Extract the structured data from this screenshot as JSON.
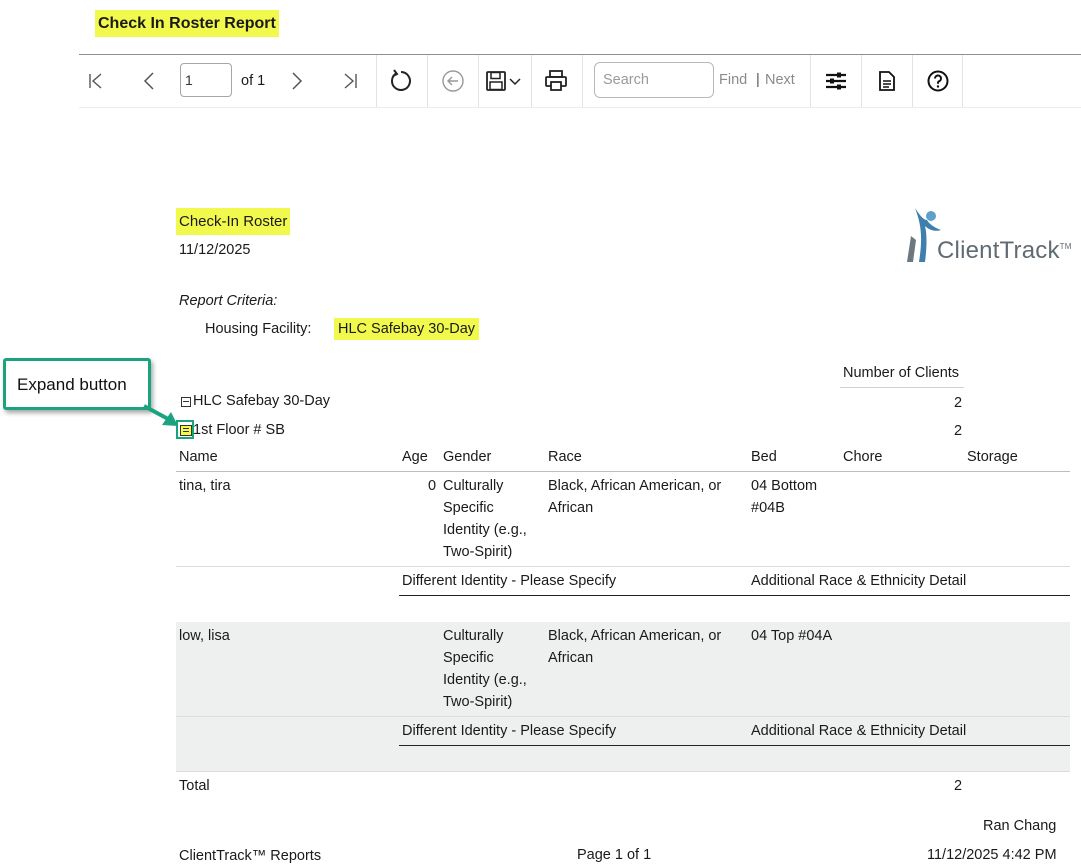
{
  "header": {
    "title": "Check In Roster Report"
  },
  "toolbar": {
    "page_value": "1",
    "of_label": "of 1",
    "search_placeholder": "Search",
    "find_label": "Find",
    "separator": "|",
    "next_label": "Next"
  },
  "report": {
    "title": "Check-In Roster",
    "date": "11/12/2025",
    "logo_text": "ClientTrack",
    "logo_tm": "TM",
    "criteria_label": "Report Criteria:",
    "facility_label": "Housing Facility:",
    "facility_value": "HLC Safebay 30-Day",
    "number_of_clients_label": "Number of Clients",
    "group": {
      "name": "HLC Safebay 30-Day",
      "count": "2"
    },
    "subgroup": {
      "name": "1st Floor # SB",
      "count": "2"
    },
    "columns": [
      "Name",
      "Age",
      "Gender",
      "Race",
      "Bed",
      "Chore",
      "Storage"
    ],
    "rows": [
      {
        "name": "tina, tira",
        "age": "0",
        "gender_lines": [
          "Culturally",
          "Specific",
          "Identity (e.g.,",
          "Two-Spirit)"
        ],
        "race_lines": [
          "Black, African American, or",
          "African"
        ],
        "bed_lines": [
          "04 Bottom",
          "#04B"
        ],
        "detail_left": "Different Identity - Please Specify",
        "detail_right": "Additional Race & Ethnicity Detail"
      },
      {
        "name": "low, lisa",
        "age": "",
        "gender_lines": [
          "Culturally",
          "Specific",
          "Identity (e.g.,",
          "Two-Spirit)"
        ],
        "race_lines": [
          "Black, African American, or",
          "African"
        ],
        "bed_lines": [
          "04 Top #04A"
        ],
        "detail_left": "Different Identity - Please Specify",
        "detail_right": "Additional Race & Ethnicity Detail"
      }
    ],
    "total_label": "Total",
    "total_count": "2",
    "user_name": "Ran Chang",
    "footer_left": "ClientTrack™ Reports",
    "footer_page": "Page 1 of 1",
    "footer_datetime": "11/12/2025 4:42 PM"
  },
  "annotation": {
    "callout_text": "Expand button"
  },
  "colors": {
    "highlight": "#f2f94d",
    "callout_border": "#1aa37e",
    "row_shade": "#eef0ef"
  },
  "icons": [
    "first-page-icon",
    "prev-page-icon",
    "next-page-icon",
    "last-page-icon",
    "refresh-icon",
    "back-icon",
    "save-icon",
    "chevron-down-icon",
    "print-icon",
    "parameters-icon",
    "document-map-icon",
    "help-icon",
    "collapse-icon",
    "expand-icon"
  ]
}
